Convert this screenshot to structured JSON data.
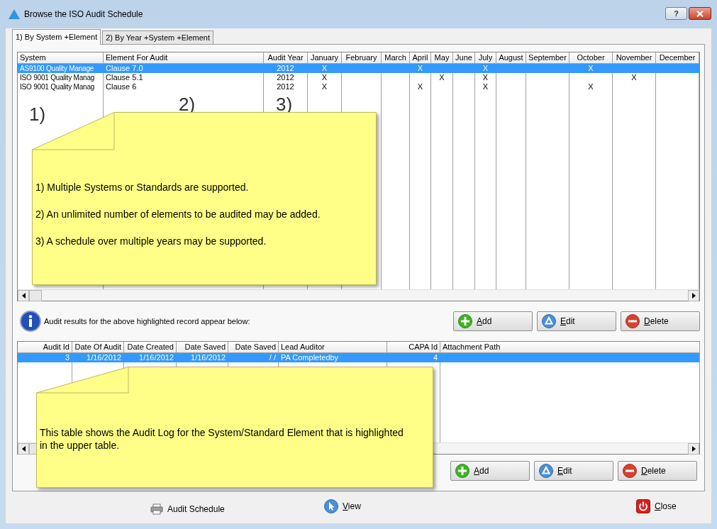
{
  "window": {
    "title": "Browse the ISO Audit Schedule",
    "help": "?"
  },
  "tabs": [
    {
      "label": "1) By System +Element",
      "selected": true
    },
    {
      "label": "2) By Year +System +Element",
      "selected": false
    }
  ],
  "schedule": {
    "columns": [
      "System",
      "Element For Audit",
      "Audit Year",
      "January",
      "February",
      "March",
      "April",
      "May",
      "June",
      "July",
      "August",
      "September",
      "October",
      "November",
      "December"
    ],
    "rows": [
      {
        "selected": true,
        "cells": [
          "AS9100 Quality Manage",
          "Clause 7.0",
          "2012",
          "X",
          null,
          null,
          "X",
          null,
          null,
          "X",
          null,
          null,
          "X",
          null,
          null
        ]
      },
      {
        "selected": false,
        "cells": [
          "ISO 9001 Quality Manag",
          "Clause 5.1",
          "2012",
          "X",
          null,
          null,
          null,
          "X",
          null,
          "X",
          null,
          null,
          null,
          "X",
          null
        ]
      },
      {
        "selected": false,
        "cells": [
          "ISO 9001 Quality Manag",
          "Clause 6",
          "2012",
          "X",
          null,
          null,
          "X",
          null,
          null,
          "X",
          null,
          null,
          "X",
          null,
          null
        ]
      }
    ],
    "callouts": [
      "1)",
      "2)",
      "3)"
    ],
    "note": [
      "1) Multiple Systems or Standards are supported.",
      "2) An unlimited number of elements to be audited may be added.",
      "3) A schedule over multiple years may be supported."
    ]
  },
  "info_text": "Audit results for the above highlighted record appear below:",
  "schedule_buttons": [
    {
      "label": "Add",
      "kind": "add"
    },
    {
      "label": "Edit",
      "kind": "edit"
    },
    {
      "label": "Delete",
      "kind": "delete"
    }
  ],
  "log": {
    "columns": [
      "Audit Id",
      "Date Of Audit",
      "Date Created",
      "Date Saved",
      "Date Saved",
      "Lead Auditor",
      "CAPA Id",
      "Attachment Path"
    ],
    "rows": [
      {
        "selected": true,
        "cells": [
          "3",
          "1/16/2012",
          "1/16/2012",
          "1/16/2012",
          "/  /",
          "PA Completedby",
          "4",
          null
        ]
      }
    ],
    "note": "This table shows the Audit Log for the System/Standard Element that is highlighted in the upper table."
  },
  "log_buttons": [
    {
      "label": "Add",
      "kind": "add"
    },
    {
      "label": "Edit",
      "kind": "edit"
    },
    {
      "label": "Delete",
      "kind": "delete"
    }
  ],
  "footer": [
    {
      "label": "Audit Schedule",
      "kind": "print"
    },
    {
      "label": "View",
      "kind": "view"
    },
    {
      "label": "Close",
      "kind": "close"
    }
  ]
}
